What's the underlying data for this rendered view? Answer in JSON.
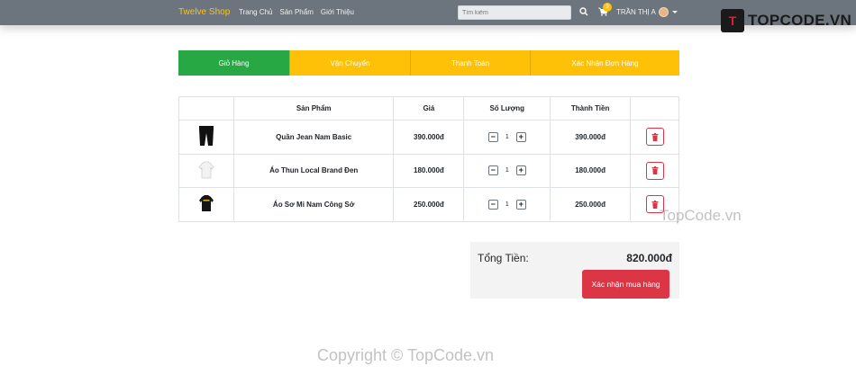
{
  "navbar": {
    "brand": "Twelve Shop",
    "links": [
      "Trang Chủ",
      "Sản Phẩm",
      "Giới Thiệu"
    ],
    "search_placeholder": "Tìm kiếm",
    "cart_count": "3",
    "user_name": "TRẦN THỊ A"
  },
  "logo": {
    "badge": "T",
    "text": "TOPCODE.VN"
  },
  "steps": [
    {
      "label": "Giỏ Hàng",
      "state": "active"
    },
    {
      "label": "Vận Chuyển",
      "state": "pending"
    },
    {
      "label": "Thanh Toán",
      "state": "pending"
    },
    {
      "label": "Xác Nhận Đơn Hàng",
      "state": "pending"
    }
  ],
  "table": {
    "headers": [
      "",
      "Sản Phẩm",
      "Giá",
      "Số Lượng",
      "Thành Tiền",
      ""
    ],
    "rows": [
      {
        "image": "jeans-thumb",
        "name": "Quần Jean Nam Basic",
        "price": "390.000đ",
        "qty": "1",
        "total": "390.000đ"
      },
      {
        "image": "white-tee-thumb",
        "name": "Áo Thun Local Brand Đen",
        "price": "180.000đ",
        "qty": "1",
        "total": "180.000đ"
      },
      {
        "image": "black-tee-thumb",
        "name": "Áo Sơ Mi Nam Công Sở",
        "price": "250.000đ",
        "qty": "1",
        "total": "250.000đ"
      }
    ],
    "minus": "−",
    "plus": "+"
  },
  "summary": {
    "label": "Tổng Tiền:",
    "value": "820.000đ",
    "confirm": "Xác nhận mua hàng"
  },
  "watermarks": {
    "side": "TopCode.vn",
    "bottom": "Copyright © TopCode.vn"
  },
  "colors": {
    "nav_bg": "#6c757d",
    "brand": "#ffc107",
    "step_active": "#28a745",
    "step_pending": "#ffc107",
    "danger": "#dc3545"
  }
}
